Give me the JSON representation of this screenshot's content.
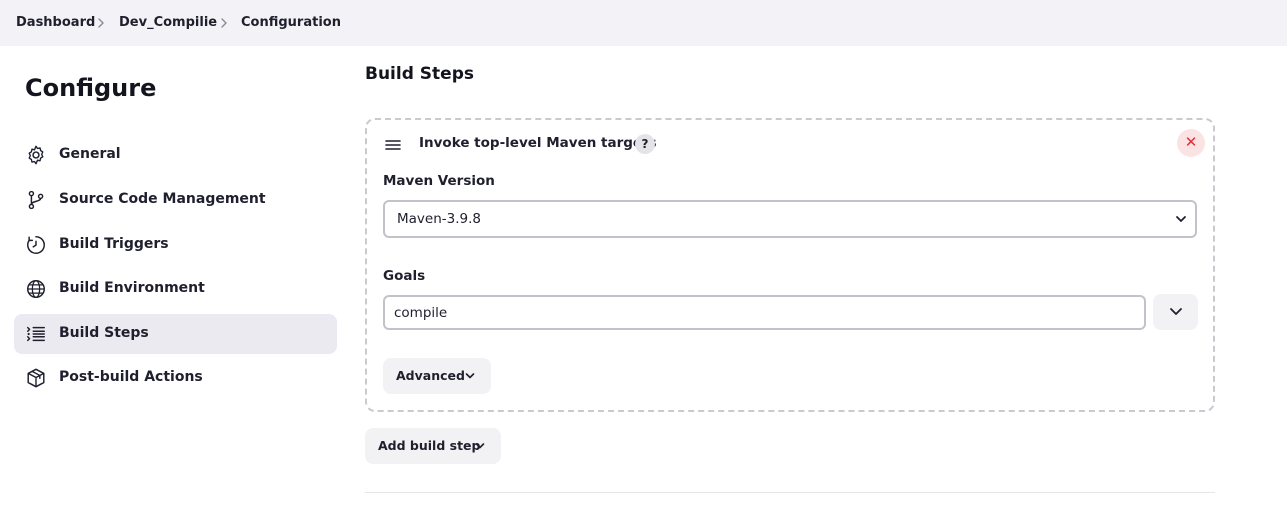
{
  "breadcrumb": {
    "items": [
      "Dashboard",
      "Dev_Compilie",
      "Configuration"
    ]
  },
  "sidebar": {
    "title": "Configure",
    "items": [
      {
        "label": "General",
        "icon": "gear-icon"
      },
      {
        "label": "Source Code Management",
        "icon": "branch-icon"
      },
      {
        "label": "Build Triggers",
        "icon": "clock-icon"
      },
      {
        "label": "Build Environment",
        "icon": "globe-icon"
      },
      {
        "label": "Build Steps",
        "icon": "list-icon",
        "active": true
      },
      {
        "label": "Post-build Actions",
        "icon": "package-icon"
      }
    ]
  },
  "main": {
    "section_title": "Build Steps",
    "step": {
      "title": "Invoke top-level Maven targets",
      "help_label": "?",
      "close_label": "✕",
      "maven_version_label": "Maven Version",
      "maven_version_value": "Maven-3.9.8",
      "goals_label": "Goals",
      "goals_value": "compile",
      "advanced_label": "Advanced"
    },
    "add_step_label": "Add build step"
  },
  "colors": {
    "accent_active_bg": "#ebeaf1",
    "close_red": "#e0303c",
    "topbar_bg": "#f3f2f6"
  }
}
